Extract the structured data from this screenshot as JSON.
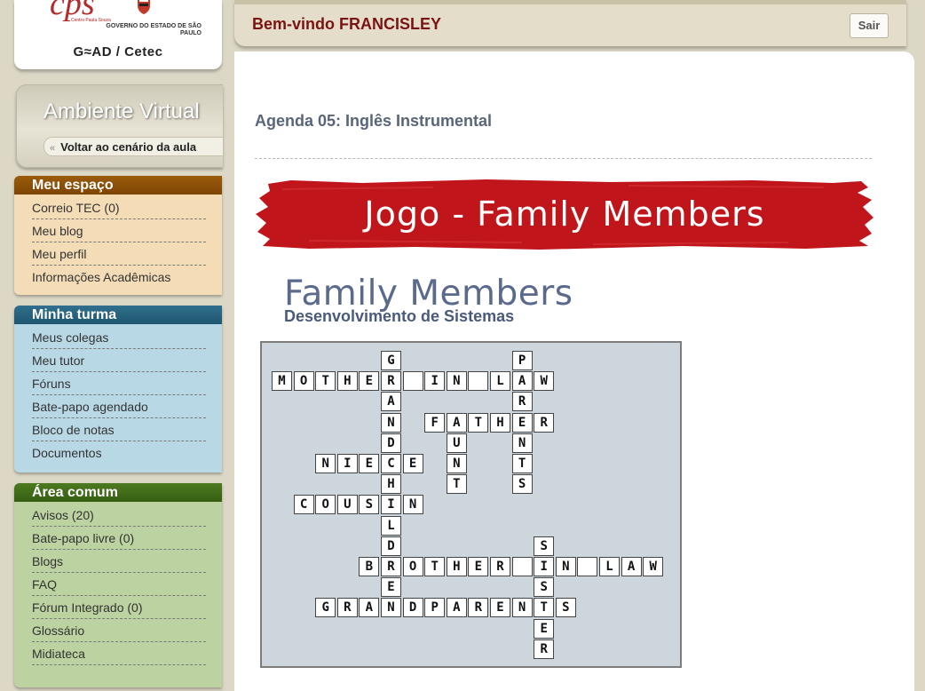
{
  "logo": {
    "cps_small": "Centro Paula Souza",
    "gov_text": "GOVERNO DO ESTADO DE SÃO PAULO",
    "gead": "G≈AD / Cetec"
  },
  "ambiente": {
    "title": "Ambiente Virtual",
    "voltar_chevron": "«",
    "voltar_label": "Voltar ao cenário da aula"
  },
  "sidebar": {
    "meu_espaco": {
      "title": "Meu espaço",
      "items": [
        "Correio TEC (0)",
        "Meu blog",
        "Meu perfil",
        "Informações Acadêmicas"
      ]
    },
    "minha_turma": {
      "title": "Minha turma",
      "items": [
        "Meus colegas",
        "Meu tutor",
        "Fóruns",
        "Bate-papo agendado",
        "Bloco de notas",
        "Documentos"
      ]
    },
    "area_comum": {
      "title": "Área comum",
      "items": [
        "Avisos (20)",
        "Bate-papo livre (0)",
        "Blogs",
        "FAQ",
        "Fórum Integrado (0)",
        "Glossário",
        "Midiateca"
      ]
    }
  },
  "header": {
    "welcome": "Bem-vindo FRANCISLEY",
    "sair": "Sair"
  },
  "main": {
    "agenda_title": "Agenda 05: Inglês Instrumental",
    "banner_title": "Jogo - Family Members",
    "puzzle_title": "Family Members",
    "puzzle_subtitle": "Desenvolvimento de Sistemas"
  },
  "crossword": {
    "words": [
      {
        "word": "GRANDCHILDREN",
        "dir": "down",
        "row": 0,
        "col": 5
      },
      {
        "word": "PARENTS",
        "dir": "down",
        "row": 0,
        "col": 11
      },
      {
        "word": "MOTHER IN LAW",
        "dir": "across",
        "row": 1,
        "col": 0
      },
      {
        "word": "FATHER",
        "dir": "across",
        "row": 3,
        "col": 7
      },
      {
        "word": "AUNT",
        "dir": "down",
        "row": 3,
        "col": 8
      },
      {
        "word": "NIECE",
        "dir": "across",
        "row": 5,
        "col": 2
      },
      {
        "word": "COUSIN",
        "dir": "across",
        "row": 7,
        "col": 1
      },
      {
        "word": "SISTER",
        "dir": "down",
        "row": 9,
        "col": 12
      },
      {
        "word": "BROTHER IN LAW",
        "dir": "across",
        "row": 10,
        "col": 4
      },
      {
        "word": "GRANDPARENTS",
        "dir": "across",
        "row": 12,
        "col": 2
      }
    ]
  }
}
